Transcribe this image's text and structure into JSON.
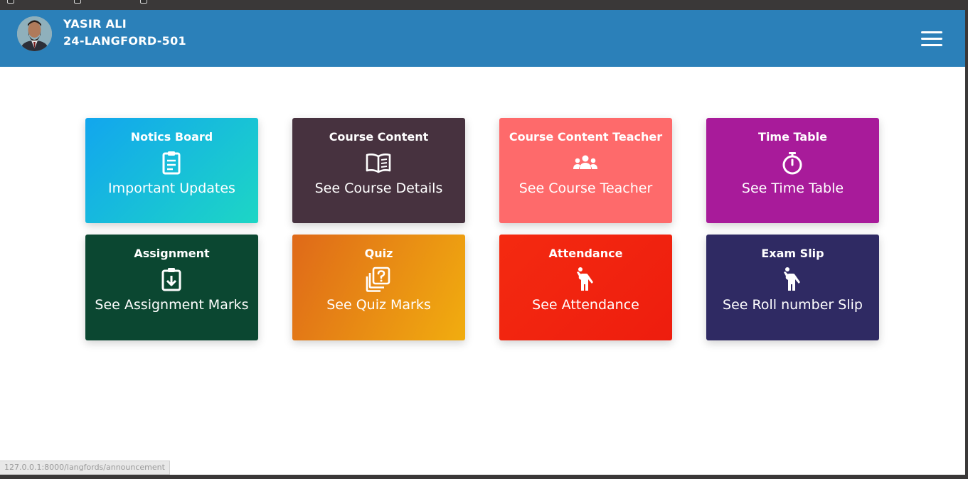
{
  "user": {
    "name": "YASIR ALI",
    "id": "24-LANGFORD-501"
  },
  "theme": {
    "header": "#2b80b9",
    "page_background": "#ffffff"
  },
  "cards": [
    {
      "title": "Notics Board",
      "subtitle": "Important Updates",
      "icon": "clipboard-list-icon",
      "bg": "linear-gradient(135deg,#12a6ee 0%,#1dd6c5 100%)"
    },
    {
      "title": "Course Content",
      "subtitle": "See Course Details",
      "icon": "open-book-icon",
      "bg": "#47323f"
    },
    {
      "title": "Course Content Teacher",
      "subtitle": "See Course Teacher",
      "icon": "users-group-icon",
      "bg": "#fe6a6b"
    },
    {
      "title": "Time Table",
      "subtitle": "See Time Table",
      "icon": "stopwatch-icon",
      "bg": "#a81b9a"
    },
    {
      "title": "Assignment",
      "subtitle": "See Assignment Marks",
      "icon": "clipboard-download-icon",
      "bg": "#0b4731"
    },
    {
      "title": "Quiz",
      "subtitle": "See Quiz Marks",
      "icon": "question-stack-icon",
      "bg": "linear-gradient(115deg,#df6919 0%,#f1ad0f 100%)"
    },
    {
      "title": "Attendance",
      "subtitle": "See Attendance",
      "icon": "person-hand-raised-icon",
      "bg": "linear-gradient(135deg,#f42a10 0%,#ee1d0e 100%)"
    },
    {
      "title": "Exam Slip",
      "subtitle": "See Roll number Slip",
      "icon": "person-hand-raised-icon",
      "bg": "#2f2a63"
    }
  ],
  "status_bar": {
    "url": "127.0.0.1:8000/langfords/announcement"
  }
}
